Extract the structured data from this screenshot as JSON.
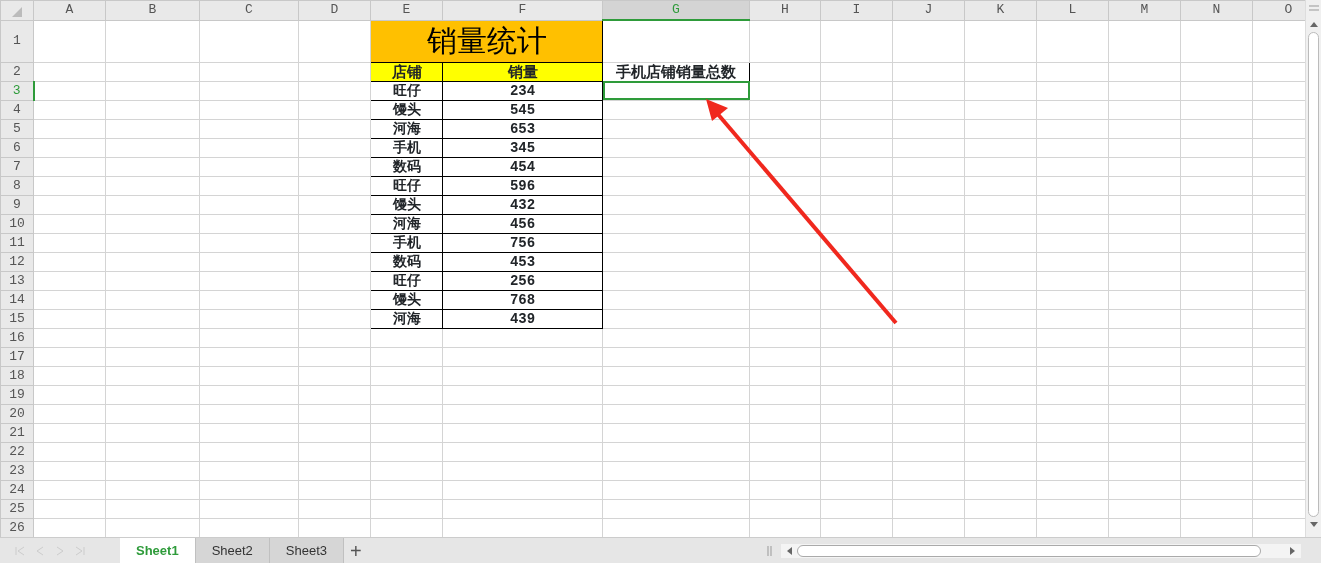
{
  "columns": [
    {
      "label": "A",
      "selected": false
    },
    {
      "label": "B",
      "selected": false
    },
    {
      "label": "C",
      "selected": false
    },
    {
      "label": "D",
      "selected": false
    },
    {
      "label": "E",
      "selected": false
    },
    {
      "label": "F",
      "selected": false
    },
    {
      "label": "G",
      "selected": true
    },
    {
      "label": "H",
      "selected": false
    },
    {
      "label": "I",
      "selected": false
    },
    {
      "label": "J",
      "selected": false
    },
    {
      "label": "K",
      "selected": false
    },
    {
      "label": "L",
      "selected": false
    },
    {
      "label": "M",
      "selected": false
    },
    {
      "label": "N",
      "selected": false
    },
    {
      "label": "O",
      "selected": false
    }
  ],
  "rows": [
    {
      "label": "1",
      "selected": false
    },
    {
      "label": "2",
      "selected": false
    },
    {
      "label": "3",
      "selected": true
    },
    {
      "label": "4",
      "selected": false
    },
    {
      "label": "5",
      "selected": false
    },
    {
      "label": "6",
      "selected": false
    },
    {
      "label": "7",
      "selected": false
    },
    {
      "label": "8",
      "selected": false
    },
    {
      "label": "9",
      "selected": false
    },
    {
      "label": "10",
      "selected": false
    },
    {
      "label": "11",
      "selected": false
    },
    {
      "label": "12",
      "selected": false
    },
    {
      "label": "13",
      "selected": false
    },
    {
      "label": "14",
      "selected": false
    },
    {
      "label": "15",
      "selected": false
    },
    {
      "label": "16",
      "selected": false
    },
    {
      "label": "17",
      "selected": false
    },
    {
      "label": "18",
      "selected": false
    },
    {
      "label": "19",
      "selected": false
    },
    {
      "label": "20",
      "selected": false
    },
    {
      "label": "21",
      "selected": false
    },
    {
      "label": "22",
      "selected": false
    },
    {
      "label": "23",
      "selected": false
    },
    {
      "label": "24",
      "selected": false
    },
    {
      "label": "25",
      "selected": false
    },
    {
      "label": "26",
      "selected": false
    }
  ],
  "sales_table": {
    "title": "销量统计",
    "headers": [
      "店铺",
      "销量"
    ],
    "records": [
      {
        "store": "旺仔",
        "sales": "234"
      },
      {
        "store": "馒头",
        "sales": "545"
      },
      {
        "store": "河海",
        "sales": "653"
      },
      {
        "store": "手机",
        "sales": "345"
      },
      {
        "store": "数码",
        "sales": "454"
      },
      {
        "store": "旺仔",
        "sales": "596"
      },
      {
        "store": "馒头",
        "sales": "432"
      },
      {
        "store": "河海",
        "sales": "456"
      },
      {
        "store": "手机",
        "sales": "756"
      },
      {
        "store": "数码",
        "sales": "453"
      },
      {
        "store": "旺仔",
        "sales": "256"
      },
      {
        "store": "馒头",
        "sales": "768"
      },
      {
        "store": "河海",
        "sales": "439"
      }
    ]
  },
  "total_label": "手机店铺销量总数",
  "sheet_tabs": [
    {
      "label": "Sheet1",
      "selected": true
    },
    {
      "label": "Sheet2",
      "selected": false
    },
    {
      "label": "Sheet3",
      "selected": false
    }
  ],
  "add_sheet": "+"
}
